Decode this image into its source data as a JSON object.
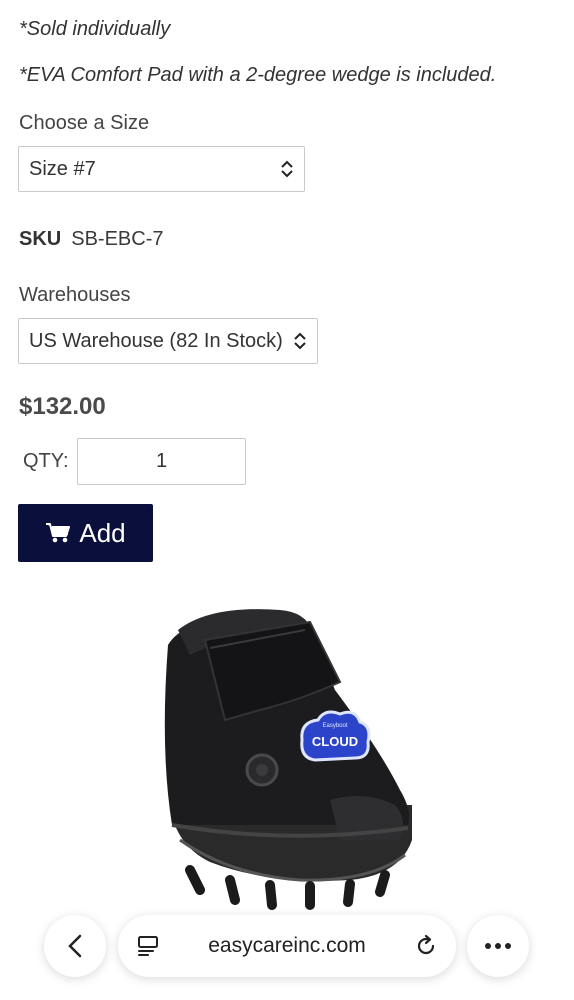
{
  "notes": [
    "*Sold individually",
    "*EVA Comfort Pad with a 2-degree wedge is included."
  ],
  "size": {
    "label": "Choose a Size",
    "selected": "Size #7"
  },
  "sku": {
    "label": "SKU",
    "value": "SB-EBC-7"
  },
  "warehouse": {
    "label": "Warehouses",
    "selected": "US Warehouse (82 In Stock)"
  },
  "price": "$132.00",
  "qty": {
    "label": "QTY:",
    "value": "1"
  },
  "add_button": {
    "label": "Add",
    "icon": "cart-icon"
  },
  "product_image": {
    "badge_text": "CLOUD",
    "badge_subtext": "Easyboot"
  },
  "browser": {
    "url": "easycareinc.com",
    "icons": [
      "back-chevron-icon",
      "tabs-icon",
      "reload-icon",
      "more-icon"
    ]
  },
  "colors": {
    "button_bg": "#0b0f3c",
    "badge_blue": "#2c44c9"
  }
}
